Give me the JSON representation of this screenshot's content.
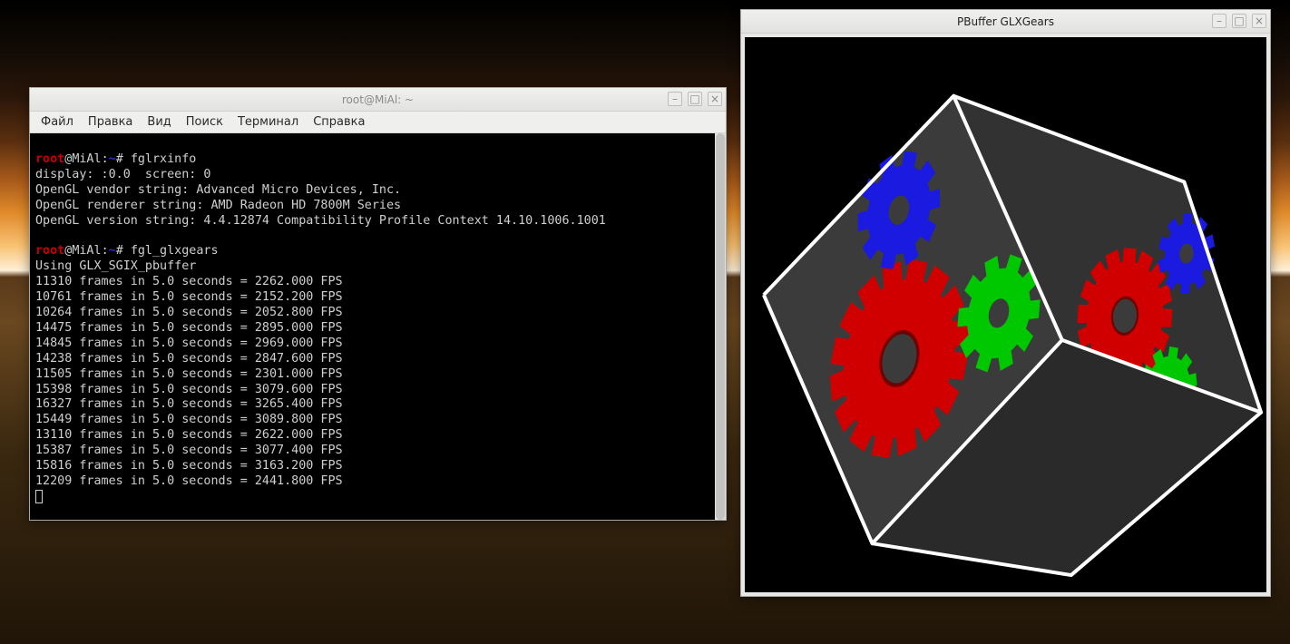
{
  "terminal": {
    "title": "root@MiAl: ~",
    "menu": [
      "Файл",
      "Правка",
      "Вид",
      "Поиск",
      "Терминал",
      "Справка"
    ],
    "prompt": {
      "user": "root",
      "host": "MiAl",
      "path": "~",
      "sep1": "@",
      "sep2": ":",
      "hash": "# "
    },
    "cmd1": "fglrxinfo",
    "info": [
      "display: :0.0  screen: 0",
      "OpenGL vendor string: Advanced Micro Devices, Inc.",
      "OpenGL renderer string: AMD Radeon HD 7800M Series",
      "OpenGL version string: 4.4.12874 Compatibility Profile Context 14.10.1006.1001"
    ],
    "cmd2": "fgl_glxgears",
    "pbuffer": "Using GLX_SGIX_pbuffer",
    "fps_lines": [
      "11310 frames in 5.0 seconds = 2262.000 FPS",
      "10761 frames in 5.0 seconds = 2152.200 FPS",
      "10264 frames in 5.0 seconds = 2052.800 FPS",
      "14475 frames in 5.0 seconds = 2895.000 FPS",
      "14845 frames in 5.0 seconds = 2969.000 FPS",
      "14238 frames in 5.0 seconds = 2847.600 FPS",
      "11505 frames in 5.0 seconds = 2301.000 FPS",
      "15398 frames in 5.0 seconds = 3079.600 FPS",
      "16327 frames in 5.0 seconds = 3265.400 FPS",
      "15449 frames in 5.0 seconds = 3089.800 FPS",
      "13110 frames in 5.0 seconds = 2622.000 FPS",
      "15387 frames in 5.0 seconds = 3077.400 FPS",
      "15816 frames in 5.0 seconds = 3163.200 FPS",
      "12209 frames in 5.0 seconds = 2441.800 FPS"
    ]
  },
  "glx": {
    "title": "PBuffer GLXGears",
    "colors": {
      "cube_face": "#3b3b3b",
      "cube_edge": "#ffffff",
      "gear_red": "#d00000",
      "gear_green": "#00c800",
      "gear_blue": "#1a1ae0"
    }
  },
  "window_buttons": {
    "minimize": "–",
    "maximize": "□",
    "close": "×"
  }
}
